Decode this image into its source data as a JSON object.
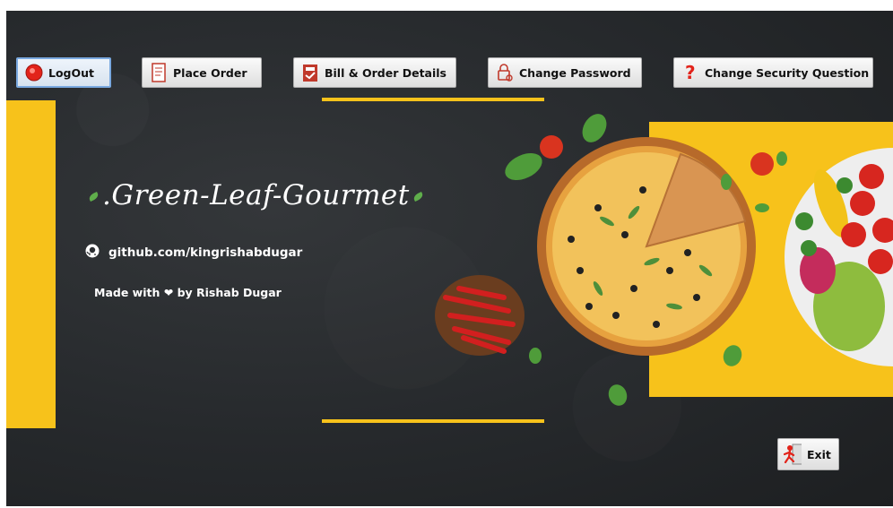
{
  "toolbar": {
    "logout_label": "LogOut",
    "place_order_label": "Place Order",
    "bill_label": "Bill & Order Details",
    "change_password_label": "Change Password",
    "change_security_label": "Change Security Question"
  },
  "brand": {
    "title": ".Green-Leaf-Gourmet",
    "github": "github.com/kingrishabdugar",
    "made_prefix": "Made with",
    "made_heart": "❤",
    "made_suffix": "by Rishab Dugar"
  },
  "footer": {
    "exit_label": "Exit"
  },
  "colors": {
    "accent_yellow": "#f7c21b",
    "board": "#2b2e31",
    "leaf_green": "#5fae4b",
    "button_active_border": "#7aa9e0"
  },
  "icons": {
    "logout": "red-record-icon",
    "place_order": "receipt-icon",
    "bill": "bill-icon",
    "change_password": "lock-key-icon",
    "change_security": "question-mark-icon",
    "github": "github-icon",
    "exit": "exit-runner-icon"
  }
}
